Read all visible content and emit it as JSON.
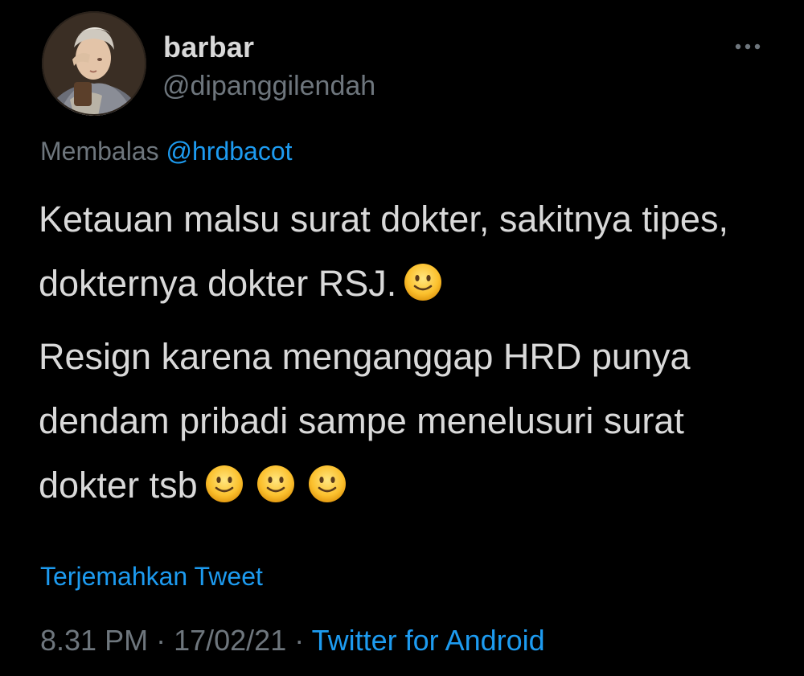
{
  "user": {
    "display_name": "barbar",
    "handle": "@dipanggilendah"
  },
  "reply": {
    "prefix": "Membalas",
    "mention": "@hrdbacot"
  },
  "tweet": {
    "paragraph_1": "Ketauan malsu surat dokter, sakitnya tipes, dokternya dokter RSJ.",
    "paragraph_2": "Resign karena menganggap HRD punya dendam pribadi sampe menelusuri surat dokter tsb",
    "paragraph_1_emoji": "slightly-smiling-face",
    "paragraph_2_emoji_count": 3
  },
  "translate_label": "Terjemahkan Tweet",
  "meta": {
    "time": "8.31 PM",
    "separator": " · ",
    "date": "17/02/21",
    "source": "Twitter for Android"
  },
  "icons": {
    "more": "more-horizontal-icon",
    "emoji": "slightly-smiling-face-emoji"
  },
  "colors": {
    "background": "#000000",
    "text": "#d9d9d9",
    "secondary": "#6e767d",
    "accent": "#1d9bf0"
  }
}
